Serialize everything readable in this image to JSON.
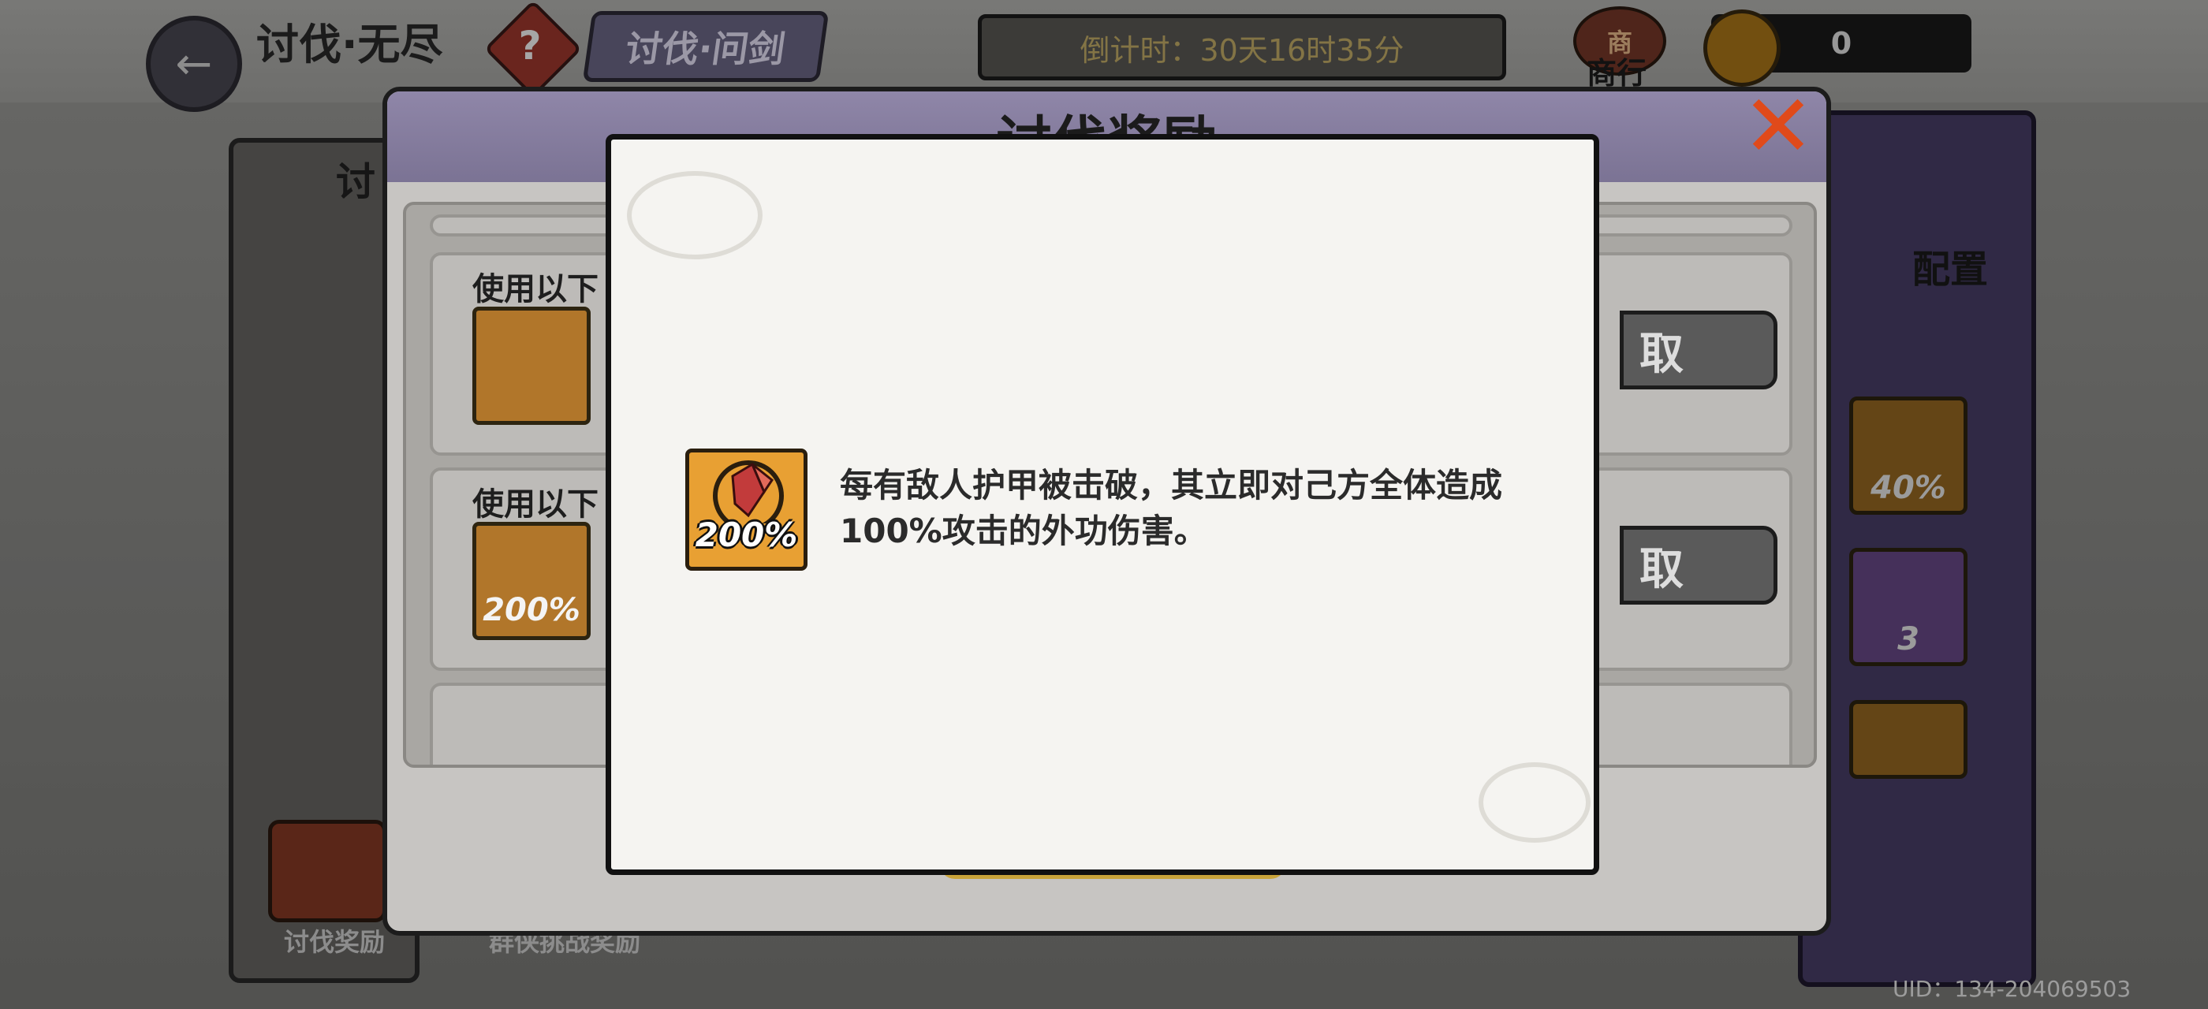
{
  "header": {
    "back_icon": "back-arrow-icon",
    "title": "讨伐·无尽",
    "help_icon": "question-icon",
    "tab_label": "讨伐·问剑",
    "countdown": "倒计时：30天16时35分",
    "shop_icon_char": "商",
    "shop_label": "商行",
    "currency_value": "0"
  },
  "background": {
    "left_panel_partial": "讨",
    "config_label": "配置",
    "right_cards": [
      {
        "value": "40%"
      },
      {
        "value": "3"
      },
      {
        "value": ""
      }
    ],
    "bottom_tabs": [
      "讨伐奖励",
      "群侠挑战奖励"
    ],
    "uid": "UID：134-204069503"
  },
  "reward_window": {
    "title": "讨伐奖励",
    "close_icon": "close-x-icon",
    "items": [
      {
        "label": "使用以下",
        "icon_value": "",
        "claim_label": "取"
      },
      {
        "label": "使用以下",
        "icon_value": "200%",
        "claim_label": "取"
      }
    ]
  },
  "tooltip": {
    "icon_value": "200%",
    "description": "每有敌人护甲被击破，其立即对己方全体造成100%攻击的外功伤害。"
  },
  "colors": {
    "accent_orange": "#e8a033",
    "header_purple": "#8f86a8",
    "close_red": "#e04a1a",
    "tooltip_bg": "#f5f4f1"
  }
}
